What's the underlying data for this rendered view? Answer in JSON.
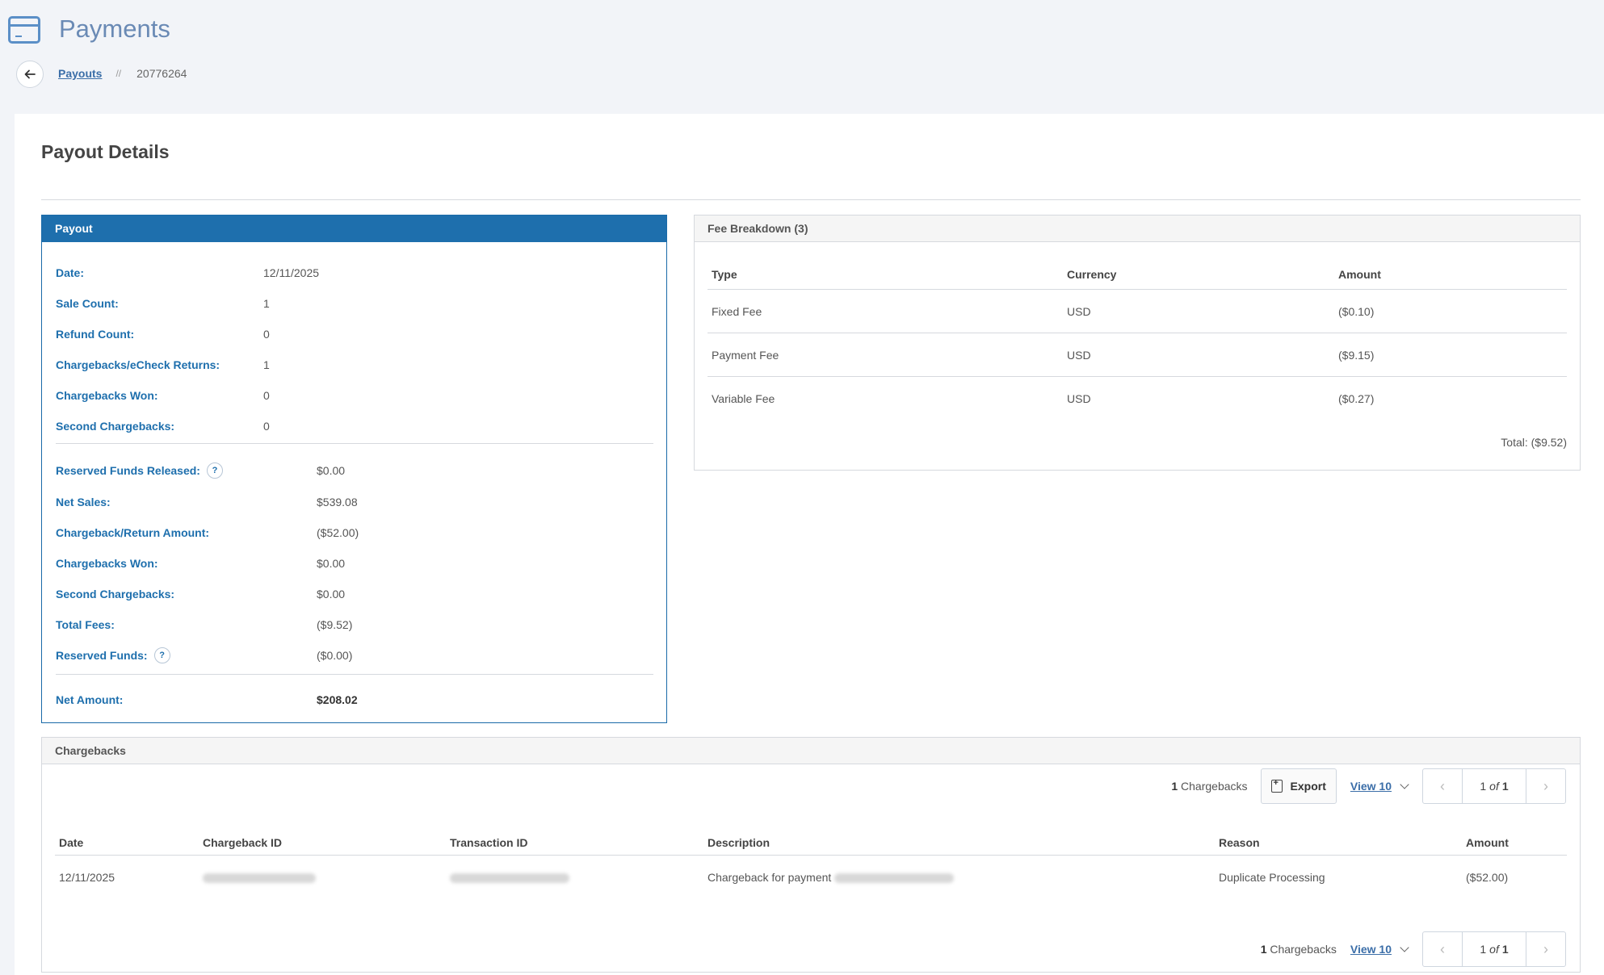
{
  "app": {
    "title": "Payments",
    "icon": "credit-card-icon"
  },
  "breadcrumb": {
    "parent": "Payouts",
    "separator": "//",
    "current": "20776264"
  },
  "page": {
    "title": "Payout Details"
  },
  "payout": {
    "header": "Payout",
    "date_label": "Date:",
    "date": "12/11/2025",
    "sale_count_label": "Sale Count:",
    "sale_count": "1",
    "refund_count_label": "Refund Count:",
    "refund_count": "0",
    "chargebacks_echeck_label": "Chargebacks/eCheck Returns:",
    "chargebacks_echeck": "1",
    "chargebacks_won_count_label": "Chargebacks Won:",
    "chargebacks_won_count": "0",
    "second_chargebacks_count_label": "Second Chargebacks:",
    "second_chargebacks_count": "0",
    "reserved_released_label": "Reserved Funds Released:",
    "reserved_released": "$0.00",
    "net_sales_label": "Net Sales:",
    "net_sales": "$539.08",
    "chargeback_return_label": "Chargeback/Return Amount:",
    "chargeback_return": "($52.00)",
    "chargebacks_won_amount_label": "Chargebacks Won:",
    "chargebacks_won_amount": "$0.00",
    "second_chargebacks_amount_label": "Second Chargebacks:",
    "second_chargebacks_amount": "$0.00",
    "total_fees_label": "Total Fees:",
    "total_fees": "($9.52)",
    "reserved_funds_label": "Reserved Funds:",
    "reserved_funds": "($0.00)",
    "net_amount_label": "Net Amount:",
    "net_amount": "$208.02",
    "help_glyph": "?"
  },
  "fees": {
    "header": "Fee Breakdown (3)",
    "columns": [
      "Type",
      "Currency",
      "Amount"
    ],
    "rows": [
      [
        "Fixed Fee",
        "USD",
        "($0.10)"
      ],
      [
        "Payment Fee",
        "USD",
        "($9.15)"
      ],
      [
        "Variable Fee",
        "USD",
        "($0.27)"
      ]
    ],
    "total": "Total: ($9.52)"
  },
  "chargebacks": {
    "header": "Chargebacks",
    "count": "1",
    "count_label": "Chargebacks",
    "export_label": "Export",
    "view_label": "View 10",
    "page_current": "1",
    "page_of": "of",
    "page_total": "1",
    "columns": [
      "Date",
      "Chargeback ID",
      "Transaction ID",
      "Description",
      "Reason",
      "Amount"
    ],
    "rows": [
      {
        "date": "12/11/2025",
        "description": "Chargeback for payment",
        "reason": "Duplicate Processing",
        "amount": "($52.00)"
      }
    ]
  }
}
